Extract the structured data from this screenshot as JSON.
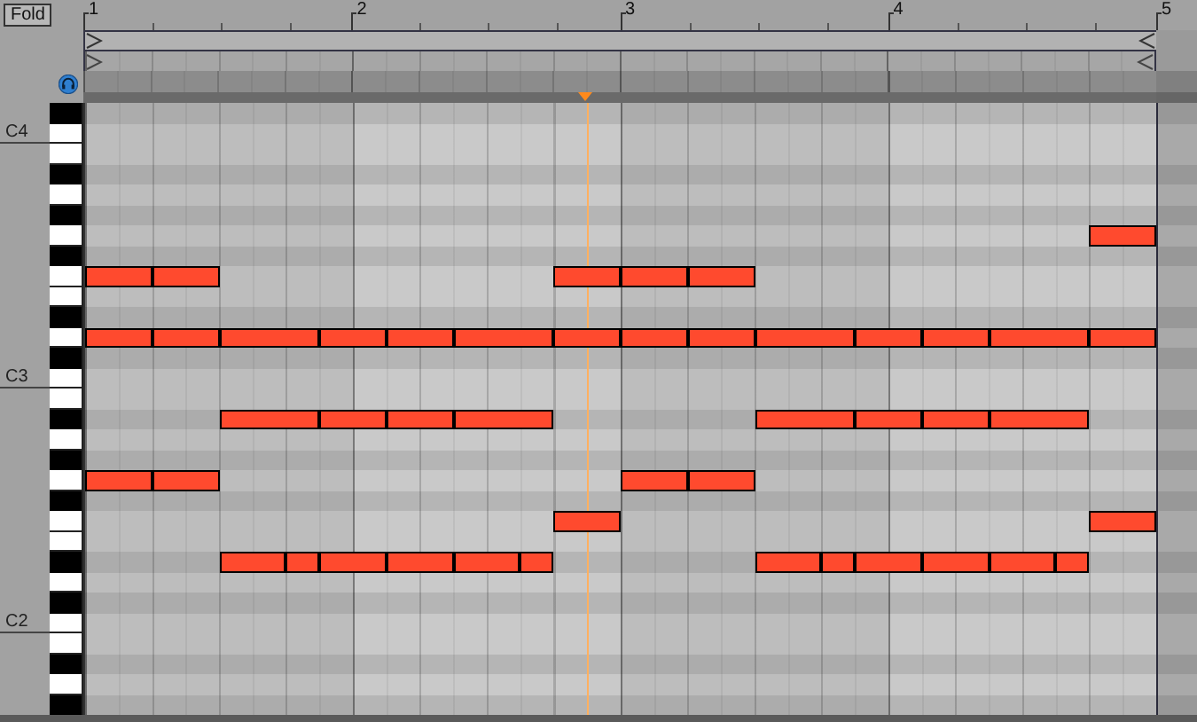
{
  "fold_button": {
    "label": "Fold"
  },
  "ruler": {
    "bars": [
      "1",
      "2",
      "3",
      "4",
      "5"
    ]
  },
  "playhead": {
    "level": 0.468
  },
  "keys": [
    {
      "kind": "black"
    },
    {
      "kind": "white",
      "label": "C4"
    },
    {
      "kind": "white"
    },
    {
      "kind": "black"
    },
    {
      "kind": "white"
    },
    {
      "kind": "black"
    },
    {
      "kind": "white",
      "events": [
        {
          "kind": "whole-rest"
        },
        {
          "kind": "whole-rest"
        },
        {
          "kind": "whole-rest"
        },
        {
          "kind": "half-rest"
        },
        {
          "kind": "quarter-rest"
        },
        {
          "kind": "quarter-note"
        }
      ]
    },
    {
      "kind": "black"
    },
    {
      "kind": "white",
      "events": [
        {
          "kind": "quarter-note"
        },
        {
          "kind": "quarter-note"
        },
        {
          "kind": "whole-rest"
        },
        {
          "kind": "quarter-rest"
        },
        {
          "kind": "quarter-note"
        },
        {
          "kind": "quarter-note"
        },
        {
          "kind": "quarter-note"
        },
        {
          "kind": "whole-rest"
        },
        {
          "kind": "half-rest"
        }
      ]
    },
    {
      "kind": "white"
    },
    {
      "kind": "black"
    },
    {
      "kind": "white",
      "events": [
        {
          "kind": "quarter-note"
        },
        {
          "kind": "quarter-note"
        },
        {
          "kind": "dotted-quarter-note"
        },
        {
          "kind": "quarter-note"
        },
        {
          "kind": "quarter-note"
        },
        {
          "kind": "dotted-quarter-note"
        },
        {
          "kind": "quarter-note"
        },
        {
          "kind": "quarter-note"
        },
        {
          "kind": "quarter-note"
        },
        {
          "kind": "dotted-quarter-note"
        },
        {
          "kind": "quarter-note"
        },
        {
          "kind": "quarter-note"
        },
        {
          "kind": "dotted-quarter-note"
        },
        {
          "kind": "quarter-note"
        }
      ]
    },
    {
      "kind": "black"
    },
    {
      "kind": "white",
      "label": "C3"
    },
    {
      "kind": "white"
    },
    {
      "kind": "black",
      "events": [
        {
          "kind": "half-rest"
        },
        {
          "kind": "dotted-quarter-note"
        },
        {
          "kind": "quarter-note"
        },
        {
          "kind": "quarter-note"
        },
        {
          "kind": "dotted-quarter-note"
        },
        {
          "kind": "half-rest"
        },
        {
          "kind": "quarter-rest"
        },
        {
          "kind": "dotted-quarter-note"
        },
        {
          "kind": "quarter-note"
        },
        {
          "kind": "quarter-note"
        },
        {
          "kind": "dotted-quarter-note"
        },
        {
          "kind": "quarter-rest"
        }
      ]
    },
    {
      "kind": "white"
    },
    {
      "kind": "black"
    },
    {
      "kind": "white",
      "events": [
        {
          "kind": "quarter-note"
        },
        {
          "kind": "quarter-note"
        },
        {
          "kind": "whole-rest"
        },
        {
          "kind": "half-rest"
        },
        {
          "kind": "quarter-note"
        },
        {
          "kind": "quarter-note"
        },
        {
          "kind": "whole-rest"
        },
        {
          "kind": "half-rest"
        }
      ]
    },
    {
      "kind": "black"
    },
    {
      "kind": "white",
      "events": [
        {
          "kind": "whole-rest"
        },
        {
          "kind": "half-rest"
        },
        {
          "kind": "quarter-rest"
        },
        {
          "kind": "quarter-note"
        },
        {
          "kind": "whole-rest"
        },
        {
          "kind": "half-rest"
        },
        {
          "kind": "quarter-rest"
        },
        {
          "kind": "quarter-note"
        }
      ]
    },
    {
      "kind": "white"
    },
    {
      "kind": "black",
      "events": [
        {
          "kind": "half-rest"
        },
        {
          "kind": "quarter-note"
        },
        {
          "kind": "eighth-note"
        },
        {
          "kind": "quarter-note"
        },
        {
          "kind": "quarter-note"
        },
        {
          "kind": "quarter-note"
        },
        {
          "kind": "eighth-note"
        },
        {
          "kind": "half-rest"
        },
        {
          "kind": "quarter-rest"
        },
        {
          "kind": "quarter-note"
        },
        {
          "kind": "eighth-note"
        },
        {
          "kind": "quarter-note"
        },
        {
          "kind": "quarter-note"
        },
        {
          "kind": "quarter-note"
        },
        {
          "kind": "eighth-note"
        },
        {
          "kind": "quarter-rest"
        }
      ]
    },
    {
      "kind": "white"
    },
    {
      "kind": "black"
    },
    {
      "kind": "white",
      "label": "C2"
    },
    {
      "kind": "white"
    },
    {
      "kind": "black"
    },
    {
      "kind": "white"
    },
    {
      "kind": "black"
    }
  ]
}
